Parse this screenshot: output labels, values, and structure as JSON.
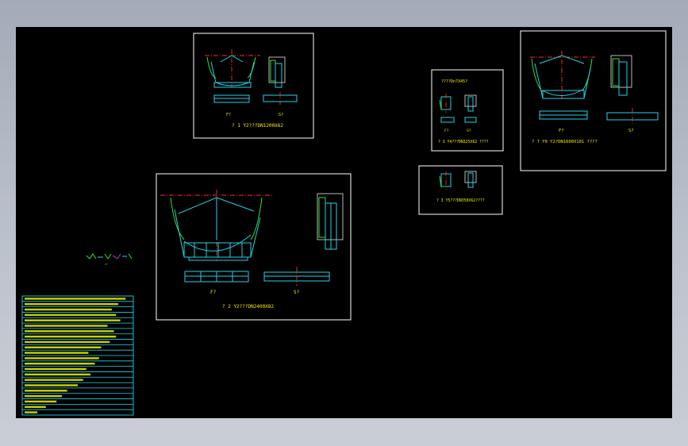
{
  "drawing": {
    "background": "#000000",
    "accent_cyan": "#22d3e6",
    "accent_yellow": "#f4f000",
    "accent_red": "#ff2a2a",
    "accent_green": "#2fe23a"
  },
  "sheets": [
    {
      "id": "s1",
      "caption": "? 1  Y2???DN1200X62",
      "view_f": "F?",
      "view_s": "S?"
    },
    {
      "id": "s2",
      "caption": "? 2  Y2???DN2400X82",
      "view_f": "F?",
      "view_s": "S?"
    },
    {
      "id": "s3",
      "title": "????Dn7X45?",
      "caption": "? 3  Y4???DN325X62  ????",
      "view_f": "F?",
      "view_s": "S?"
    },
    {
      "id": "s4",
      "caption": "? 3  Y5???DN350X62????"
    },
    {
      "id": "s5",
      "caption": "? 7  Y9  Y2?DN1600X101  ????",
      "view_f": "F?",
      "view_s": "S?"
    }
  ],
  "legend": {
    "label": "??"
  },
  "notes_table": {
    "rows": 22
  }
}
